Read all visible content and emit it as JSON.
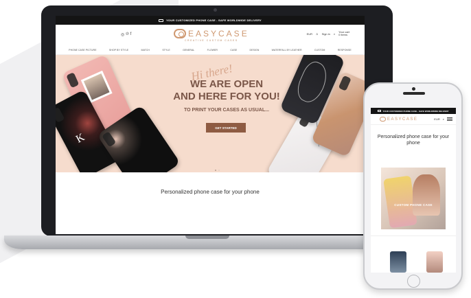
{
  "desktop": {
    "topbar_text": "YOUR CUSTOMIZED PHONE CASE - SAFE WORLDWIDE DELIVERY",
    "social_icons": [
      "instagram-icon",
      "pinterest-icon",
      "facebook-icon"
    ],
    "logo": {
      "name": "EASYCASE",
      "tagline": "CREATIVE CUSTOM CASES"
    },
    "header_right": {
      "currency": "EUR",
      "signin": "Sign in",
      "cart": "Your cart\n0 items"
    },
    "nav": [
      "PHONE CASE PICTURE",
      "SHOP BY STYLE",
      "MATCH",
      "STYLE",
      "GENERAL",
      "FLOWER",
      "CASE",
      "DESIGN",
      "WATERFALL BY LEATHER",
      "CUSTOM",
      "RESPONSE"
    ],
    "hero": {
      "script": "Hi there!",
      "heading_line1": "WE ARE OPEN",
      "heading_line2": "AND HERE FOR YOU!",
      "subheading": "TO PRINT YOUR CASES AS USUAL...",
      "cta": "GET STARTED"
    },
    "section_title": "Personalized phone case for your phone"
  },
  "mobile": {
    "topbar_text": "YOUR CUSTOMIZED PHONE CASE - SAFE WORLDWIDE DELIVERY",
    "logo_name": "EASYCASE",
    "currency": "EUR",
    "title": "Personalized phone case for your phone",
    "photo_caption": "CUSTOM PHONE CASE"
  },
  "colors": {
    "accent": "#cf9870",
    "hero_bg": "#f6dccd",
    "cta_bg": "#8e5b42",
    "heading": "#7a5648"
  }
}
